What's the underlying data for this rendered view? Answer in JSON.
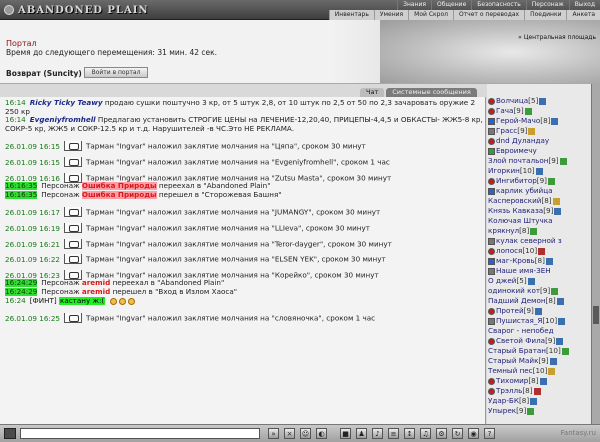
{
  "header": {
    "logo": "ABANDONED PLAIN",
    "menu_top": [
      "Знания",
      "Общение",
      "Безопасность",
      "Персонаж",
      "Выход"
    ],
    "menu_sub": [
      "Инвентарь",
      "Умения",
      "Мой Скрол",
      "Отчет о переводах",
      "Поединки",
      "Анкета"
    ]
  },
  "location": {
    "title": "Портал",
    "timer": "Время до следующего перемещения: 31 мин. 42 сек.",
    "return_label": "Возврат (Suncity)",
    "portal_button": "Войти в портал",
    "place_label": "Центральная площадь"
  },
  "tabs": [
    "Чат",
    "Системные сообщения"
  ],
  "chat": [
    {
      "time": "16:14",
      "nick": "Ricky Ticky Teawy",
      "text": "продаю сушки поштучно 3 кр, от 5 штук 2,8, от 10 штук по 2,5 от 50 по 2,3 зачаровать оружие 2 250 кр"
    },
    {
      "time": "16:14",
      "nick": "Evgeniyfromhell",
      "text": "Предлагаю установить СТРОГИЕ ЦЕНЫ на ЛЕЧЕНИЕ-12,20,40, ПРИЦЕПЫ-4,4,5 и ОБКАСТЫ- ЖЖ5-8 кр, СОКР-5 кр, ЖЖ5 и СОКР-12.5 кр и т.д. Нарушителей -в ЧС.Это НЕ РЕКЛАМА."
    },
    {
      "time": "26.01.09 16:15",
      "text": "Тарман \"Ingvar\" наложил заклятие молчания на \"Цяпа\", сроком 30 минут"
    },
    {
      "time": "26.01.09 16:15",
      "text": "Тарман \"Ingvar\" наложил заклятие молчания на \"Evgeniyfromhell\", сроком 1 час"
    },
    {
      "time": "26.01.09 16:16",
      "text": "Тарман \"Ingvar\" наложил заклятие молчания на \"Zutsu Masta\", сроком 30 минут"
    },
    {
      "time": "16:16:35",
      "prefix": "Персонаж",
      "nick": "Ошибка Природы",
      "text": "переехал в \"Abandoned Plain\""
    },
    {
      "time": "16:16:35",
      "prefix": "Персонаж",
      "nick": "Ошибка Природы",
      "text": "перешел в \"Сторожевая Башня\""
    },
    {
      "time": "26.01.09 16:17",
      "text": "Тарман \"Ingvar\" наложил заклятие молчания на \"JUMANGY\", сроком 30 минут"
    },
    {
      "time": "26.01.09 16:19",
      "text": "Тарман \"Ingvar\" наложил заклятие молчания на \"LLIeva\", сроком 30 минут"
    },
    {
      "time": "26.01.09 16:21",
      "text": "Тарман \"Ingvar\" наложил заклятие молчания на \"Teror-dayger\", сроком 30 минут"
    },
    {
      "time": "26.01.09 16:22",
      "text": "Тарман \"Ingvar\" наложил заклятие молчания на \"ELSEN YEK\", сроком 30 минут"
    },
    {
      "time": "26.01.09 16:23",
      "text": "Тарман \"Ingvar\" наложил заклятие молчания на \"Корейко\", сроком 30 минут"
    },
    {
      "time": "16:24:29",
      "prefix": "Персонаж",
      "nick": "aremid",
      "text": "переехал в \"Abandoned Plain\""
    },
    {
      "time": "16:24:29",
      "prefix": "Персонаж",
      "nick": "aremid",
      "text": "перешел в \"Вход в Излом Хаоса\""
    },
    {
      "time": "16:24",
      "prefix": "[ФИНТ]",
      "nick": "кастану ж:(",
      "text": ""
    },
    {
      "time": "26.01.09 16:25",
      "text": "Тарман \"Ingvar\" наложил заклятие молчания на \"словяночка\", сроком 1 час"
    }
  ],
  "players": [
    {
      "name": "Волчица",
      "level": "[5]"
    },
    {
      "name": "Гача",
      "level": "[9]"
    },
    {
      "name": "Герой-Мачо",
      "level": "[8]"
    },
    {
      "name": "Грасс",
      "level": "[9]"
    },
    {
      "name": "dnd Дуландау",
      "level": ""
    },
    {
      "name": "Евроимечу",
      "level": ""
    },
    {
      "name": "Злой почтальон",
      "level": "[9]"
    },
    {
      "name": "Игоркин",
      "level": "[10]"
    },
    {
      "name": "Ингибитор",
      "level": "[9]"
    },
    {
      "name": "карлик убийца",
      "level": ""
    },
    {
      "name": "Касперовский",
      "level": "[8]"
    },
    {
      "name": "Князь Кавказа",
      "level": "[9]"
    },
    {
      "name": "Колючая Штучка",
      "level": ""
    },
    {
      "name": "крякнул",
      "level": "[8]"
    },
    {
      "name": "кулак северной з",
      "level": ""
    },
    {
      "name": "лопося",
      "level": "[10]"
    },
    {
      "name": "маг-Кровь",
      "level": "[8]"
    },
    {
      "name": "Наше имя-ЗЕН",
      "level": ""
    },
    {
      "name": "О джей",
      "level": "[5]"
    },
    {
      "name": "одинокий кот",
      "level": "[9]"
    },
    {
      "name": "Падший Демон",
      "level": "[8]"
    },
    {
      "name": "Протей",
      "level": "[9]"
    },
    {
      "name": "Пушистая_Я",
      "level": "[10]"
    },
    {
      "name": "Сварог - непобед",
      "level": ""
    },
    {
      "name": "Светой Фила",
      "level": "[9]"
    },
    {
      "name": "Старый Братан",
      "level": "[10]"
    },
    {
      "name": "Старый Майк",
      "level": "[9]"
    },
    {
      "name": "Темный пес",
      "level": "[10]"
    },
    {
      "name": "Тихомир",
      "level": "[8]"
    },
    {
      "name": "Трэлль",
      "level": "[8]"
    },
    {
      "name": "Удар-БК",
      "level": "[8]"
    },
    {
      "name": "Упырек",
      "level": "[9]"
    }
  ],
  "bottom": {
    "watermark": "Fantasy.ru"
  }
}
